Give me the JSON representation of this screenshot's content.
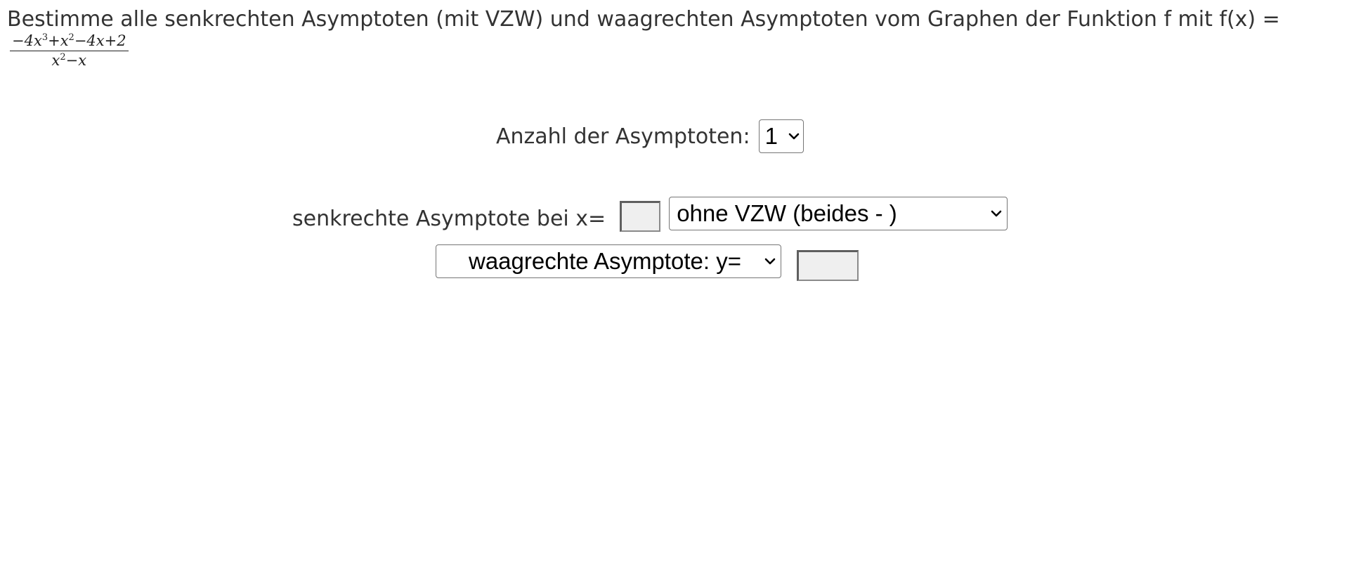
{
  "question": {
    "text": "Bestimme alle senkrechten Asymptoten (mit VZW) und waagrechten Asymptoten vom Graphen der Funktion f mit f(x) ="
  },
  "function": {
    "numerator": {
      "term1_prefix": "−4x",
      "term1_exp": "3",
      "term2_prefix": "+x",
      "term2_exp": "2",
      "rest": "−4x+2"
    },
    "denominator": {
      "prefix": "x",
      "exp": "2",
      "rest": "−x"
    }
  },
  "count_row": {
    "label": "Anzahl der Asymptoten:",
    "selected": "1"
  },
  "vertical_row": {
    "label": "senkrechte Asymptote bei x=",
    "input_value": "",
    "vzw_selected": "ohne VZW (beides - )"
  },
  "horizontal_row": {
    "type_selected": "waagrechte Asymptote: y=",
    "input_value": ""
  },
  "icons": {
    "dropdown": "chevron-down-icon"
  }
}
